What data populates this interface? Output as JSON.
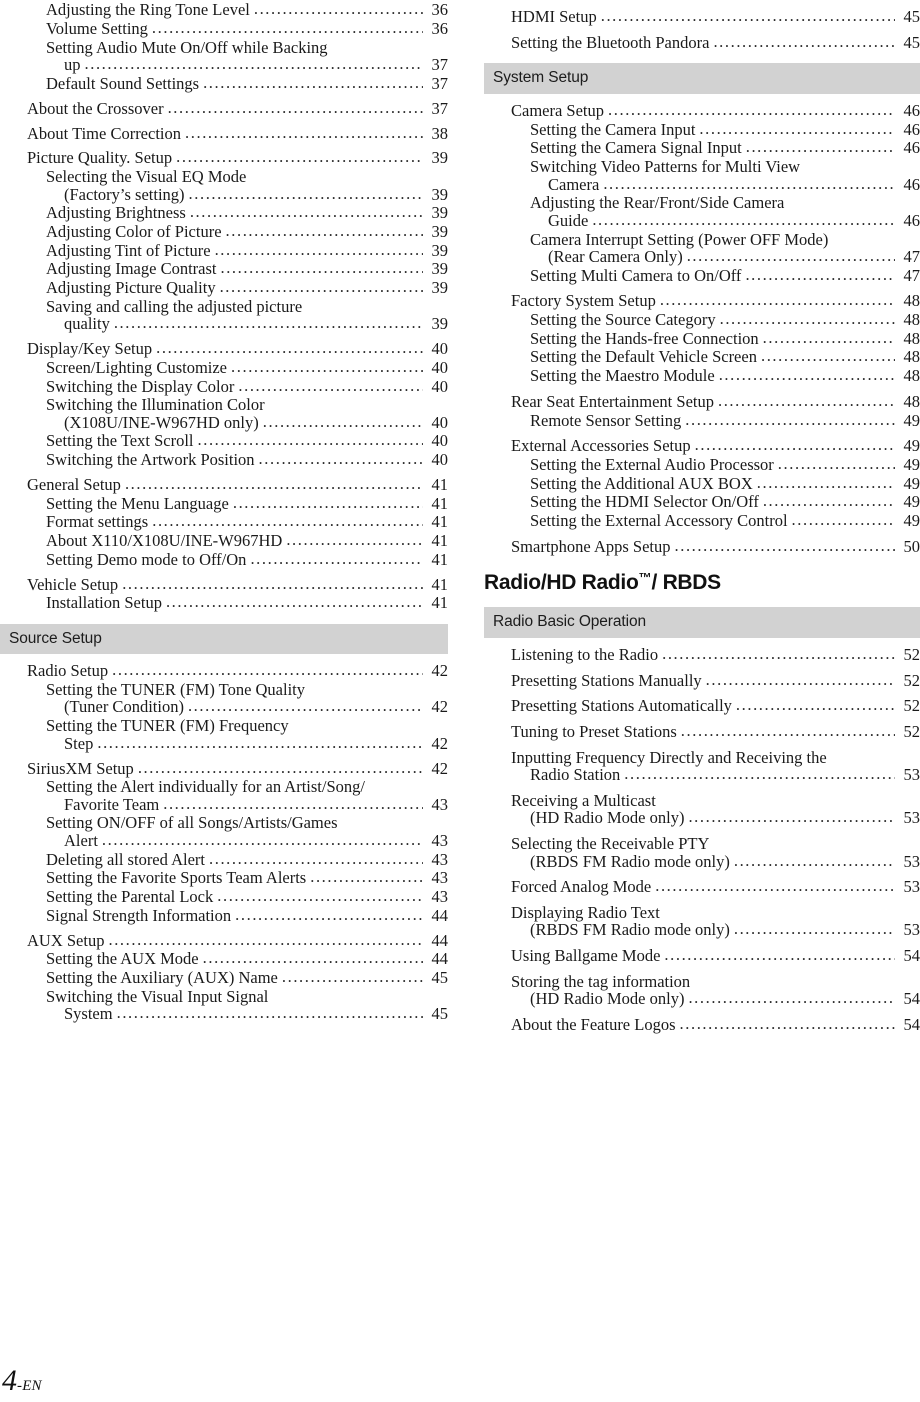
{
  "page": {
    "folio_number": "4",
    "folio_suffix": "-EN"
  },
  "left_column": {
    "blocks": [
      {
        "type": "entries",
        "items": [
          {
            "level": 2,
            "title": "Adjusting the Ring Tone Level",
            "page": "36"
          },
          {
            "level": 2,
            "title": "Volume Setting",
            "page": "36"
          },
          {
            "level": 2,
            "title": "Setting Audio Mute On/Off while Backing",
            "page": ""
          },
          {
            "level": "cont2",
            "title": "up",
            "page": "37"
          },
          {
            "level": 2,
            "title": "Default Sound Settings",
            "page": "37"
          },
          {
            "level": 1,
            "title": "About the Crossover",
            "page": "37"
          },
          {
            "level": 1,
            "title": "About Time Correction",
            "page": "38"
          },
          {
            "level": 1,
            "title": "Picture Quality. Setup",
            "page": "39"
          },
          {
            "level": 2,
            "title": "Selecting the Visual EQ Mode",
            "page": ""
          },
          {
            "level": "cont2",
            "title": "(Factory’s setting)",
            "page": "39"
          },
          {
            "level": 2,
            "title": "Adjusting Brightness",
            "page": "39"
          },
          {
            "level": 2,
            "title": "Adjusting Color of Picture",
            "page": "39"
          },
          {
            "level": 2,
            "title": "Adjusting Tint of Picture",
            "page": "39"
          },
          {
            "level": 2,
            "title": "Adjusting Image Contrast",
            "page": "39"
          },
          {
            "level": 2,
            "title": "Adjusting Picture Quality",
            "page": "39"
          },
          {
            "level": 2,
            "title": "Saving and calling the adjusted picture",
            "page": ""
          },
          {
            "level": "cont2",
            "title": "quality",
            "page": "39"
          },
          {
            "level": 1,
            "title": "Display/Key Setup",
            "page": "40"
          },
          {
            "level": 2,
            "title": "Screen/Lighting Customize",
            "page": "40"
          },
          {
            "level": 2,
            "title": "Switching the Display Color",
            "page": "40"
          },
          {
            "level": 2,
            "title": "Switching the Illumination Color",
            "page": ""
          },
          {
            "level": "cont2",
            "title": "(X108U/INE-W967HD only)",
            "page": "40"
          },
          {
            "level": 2,
            "title": "Setting the Text Scroll",
            "page": "40"
          },
          {
            "level": 2,
            "title": "Switching the Artwork Position",
            "page": "40"
          },
          {
            "level": 1,
            "title": "General Setup",
            "page": "41"
          },
          {
            "level": 2,
            "title": "Setting the Menu Language",
            "page": "41"
          },
          {
            "level": 2,
            "title": "Format settings",
            "page": "41"
          },
          {
            "level": 2,
            "title": "About X110/X108U/INE-W967HD",
            "page": "41"
          },
          {
            "level": 2,
            "title": "Setting Demo mode to Off/On",
            "page": "41"
          },
          {
            "level": 1,
            "title": "Vehicle Setup",
            "page": "41"
          },
          {
            "level": 2,
            "title": "Installation Setup",
            "page": "41"
          }
        ]
      },
      {
        "type": "section_bar",
        "title": "Source Setup"
      },
      {
        "type": "entries",
        "items": [
          {
            "level": 1,
            "title": "Radio Setup",
            "page": "42"
          },
          {
            "level": 2,
            "title": "Setting the TUNER (FM) Tone Quality",
            "page": ""
          },
          {
            "level": "cont2",
            "title": "(Tuner Condition)",
            "page": "42"
          },
          {
            "level": 2,
            "title": "Setting the TUNER (FM) Frequency",
            "page": ""
          },
          {
            "level": "cont2",
            "title": "Step",
            "page": "42"
          },
          {
            "level": 1,
            "title": "SiriusXM Setup",
            "page": "42"
          },
          {
            "level": 2,
            "title": "Setting the Alert individually for an Artist/Song/",
            "page": ""
          },
          {
            "level": "cont2",
            "title": "Favorite Team",
            "page": "43"
          },
          {
            "level": 2,
            "title": "Setting ON/OFF of all Songs/Artists/Games",
            "page": ""
          },
          {
            "level": "cont2",
            "title": "Alert",
            "page": "43"
          },
          {
            "level": 2,
            "title": "Deleting all stored Alert",
            "page": "43"
          },
          {
            "level": 2,
            "title": "Setting the Favorite Sports Team Alerts",
            "page": "43"
          },
          {
            "level": 2,
            "title": "Setting the Parental Lock",
            "page": "43"
          },
          {
            "level": 2,
            "title": "Signal Strength Information",
            "page": "44"
          },
          {
            "level": 1,
            "title": "AUX Setup",
            "page": "44"
          },
          {
            "level": 2,
            "title": "Setting the AUX Mode",
            "page": "44"
          },
          {
            "level": 2,
            "title": "Setting the Auxiliary (AUX) Name",
            "page": "45"
          },
          {
            "level": 2,
            "title": "Switching the Visual Input Signal",
            "page": ""
          },
          {
            "level": "cont2",
            "title": "System",
            "page": "45"
          }
        ]
      }
    ]
  },
  "right_column": {
    "blocks": [
      {
        "type": "entries",
        "items": [
          {
            "level": 1,
            "title": "HDMI Setup",
            "page": "45"
          },
          {
            "level": 1,
            "title": "Setting the Bluetooth Pandora",
            "suffix_symbol": "®",
            "page": "45"
          }
        ]
      },
      {
        "type": "section_bar",
        "title": "System Setup"
      },
      {
        "type": "entries",
        "items": [
          {
            "level": 1,
            "title": "Camera Setup",
            "page": "46"
          },
          {
            "level": 2,
            "title": "Setting the Camera Input",
            "page": "46"
          },
          {
            "level": 2,
            "title": "Setting the Camera Signal Input",
            "page": "46"
          },
          {
            "level": 2,
            "title": "Switching Video Patterns for Multi View",
            "page": ""
          },
          {
            "level": "cont2",
            "title": "Camera",
            "page": "46"
          },
          {
            "level": 2,
            "title": "Adjusting the Rear/Front/Side Camera",
            "page": ""
          },
          {
            "level": "cont2",
            "title": "Guide",
            "page": "46"
          },
          {
            "level": 2,
            "title": "Camera Interrupt Setting (Power OFF Mode)",
            "page": ""
          },
          {
            "level": "cont2",
            "title": "(Rear Camera Only)",
            "page": "47"
          },
          {
            "level": 2,
            "title": "Setting Multi Camera to On/Off",
            "page": "47"
          },
          {
            "level": 1,
            "title": "Factory System Setup",
            "page": "48"
          },
          {
            "level": 2,
            "title": "Setting the Source Category",
            "page": "48"
          },
          {
            "level": 2,
            "title": "Setting the Hands-free Connection",
            "page": "48"
          },
          {
            "level": 2,
            "title": "Setting the Default Vehicle Screen",
            "page": "48"
          },
          {
            "level": 2,
            "title": "Setting the Maestro Module",
            "page": "48"
          },
          {
            "level": 1,
            "title": "Rear Seat Entertainment Setup",
            "page": "48"
          },
          {
            "level": 2,
            "title": "Remote Sensor Setting",
            "page": "49"
          },
          {
            "level": 1,
            "title": "External Accessories Setup",
            "page": "49"
          },
          {
            "level": 2,
            "title": "Setting the External Audio Processor",
            "page": "49"
          },
          {
            "level": 2,
            "title": "Setting the Additional AUX BOX",
            "page": "49"
          },
          {
            "level": 2,
            "title": "Setting the HDMI Selector On/Off",
            "page": "49"
          },
          {
            "level": 2,
            "title": "Setting the External Accessory Control",
            "page": "49"
          },
          {
            "level": 1,
            "title": "Smartphone Apps Setup",
            "page": "50"
          }
        ]
      },
      {
        "type": "chapter_head",
        "title": "Radio/HD Radio",
        "trademark": "™",
        "title_tail": "/ RBDS"
      },
      {
        "type": "section_bar",
        "title": "Radio Basic Operation"
      },
      {
        "type": "entries",
        "items": [
          {
            "level": 1,
            "title": "Listening to the Radio",
            "page": "52"
          },
          {
            "level": 1,
            "title": "Presetting Stations Manually",
            "page": "52"
          },
          {
            "level": 1,
            "title": "Presetting Stations Automatically",
            "page": "52"
          },
          {
            "level": 1,
            "title": "Tuning to Preset Stations",
            "page": "52"
          },
          {
            "level": 1,
            "title": "Inputting Frequency Directly and Receiving the",
            "page": ""
          },
          {
            "level": "cont1",
            "title": "Radio Station",
            "page": "53"
          },
          {
            "level": 1,
            "title": "Receiving a Multicast",
            "page": ""
          },
          {
            "level": "cont1",
            "title": "(HD Radio Mode only)",
            "page": "53"
          },
          {
            "level": 1,
            "title": "Selecting the Receivable PTY",
            "page": ""
          },
          {
            "level": "cont1",
            "title": "(RBDS FM Radio mode only)",
            "page": "53"
          },
          {
            "level": 1,
            "title": "Forced Analog Mode",
            "page": "53"
          },
          {
            "level": 1,
            "title": "Displaying Radio Text",
            "page": ""
          },
          {
            "level": "cont1",
            "title": "(RBDS FM Radio mode only)",
            "page": "53"
          },
          {
            "level": 1,
            "title": "Using Ballgame Mode",
            "page": "54"
          },
          {
            "level": 1,
            "title": "Storing the tag information",
            "page": ""
          },
          {
            "level": "cont1",
            "title": "(HD Radio Mode only)",
            "page": "54"
          },
          {
            "level": 1,
            "title": "About the Feature Logos",
            "page": "54"
          }
        ]
      }
    ]
  }
}
